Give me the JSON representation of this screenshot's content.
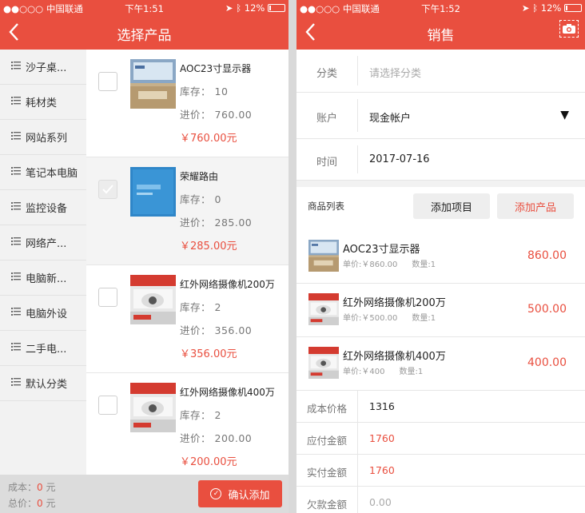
{
  "left": {
    "status": {
      "carrier": "●●○○○ 中国联通",
      "time": "下午1:51",
      "battery": "12%"
    },
    "title": "选择产品",
    "categories": [
      "沙子桌...",
      "耗材类",
      "网站系列",
      "笔记本电脑",
      "监控设备",
      "网络产...",
      "电脑新...",
      "电脑外设",
      "二手电...",
      "默认分类"
    ],
    "stock_label": "库存：",
    "cost_label": "进价：",
    "products": [
      {
        "name": "AOC23寸显示器",
        "stock": "10",
        "cost": "760.00",
        "price": "￥760.00元",
        "checked": false
      },
      {
        "name": "荣耀路由",
        "stock": "0",
        "cost": "285.00",
        "price": "￥285.00元",
        "checked": true
      },
      {
        "name": "红外网络摄像机200万",
        "stock": "2",
        "cost": "356.00",
        "price": "￥356.00元",
        "checked": false
      },
      {
        "name": "红外网络摄像机400万",
        "stock": "2",
        "cost": "200.00",
        "price": "￥200.00元",
        "checked": false
      }
    ],
    "footer": {
      "cost_label": "成本：",
      "cost_value": "0",
      "total_label": "总价：",
      "total_value": "0",
      "unit": "元",
      "confirm": "确认添加"
    }
  },
  "right": {
    "status": {
      "carrier": "●●○○○ 中国联通",
      "time": "下午1:52",
      "battery": "12%"
    },
    "title": "销售",
    "category": {
      "label": "分类",
      "placeholder": "请选择分类"
    },
    "account": {
      "label": "账户",
      "value": "现金帐户"
    },
    "date": {
      "label": "时间",
      "value": "2017-07-16"
    },
    "list_label": "商品列表",
    "add_item": "添加项目",
    "add_product": "添加产品",
    "sales": [
      {
        "name": "AOC23寸显示器",
        "unit_price": "单价:￥860.00",
        "qty": "数量:1",
        "amount": "860.00"
      },
      {
        "name": "红外网络摄像机200万",
        "unit_price": "单价:￥500.00",
        "qty": "数量:1",
        "amount": "500.00"
      },
      {
        "name": "红外网络摄像机400万",
        "unit_price": "单价:￥400",
        "qty": "数量:1",
        "amount": "400.00"
      }
    ],
    "summary": [
      {
        "label": "成本价格",
        "value": "1316"
      },
      {
        "label": "应付金额",
        "value": "1760"
      },
      {
        "label": "实付金额",
        "value": "1760"
      },
      {
        "label": "欠款金额",
        "value": "0.00"
      }
    ]
  },
  "colors": {
    "accent": "#e94f3f"
  }
}
